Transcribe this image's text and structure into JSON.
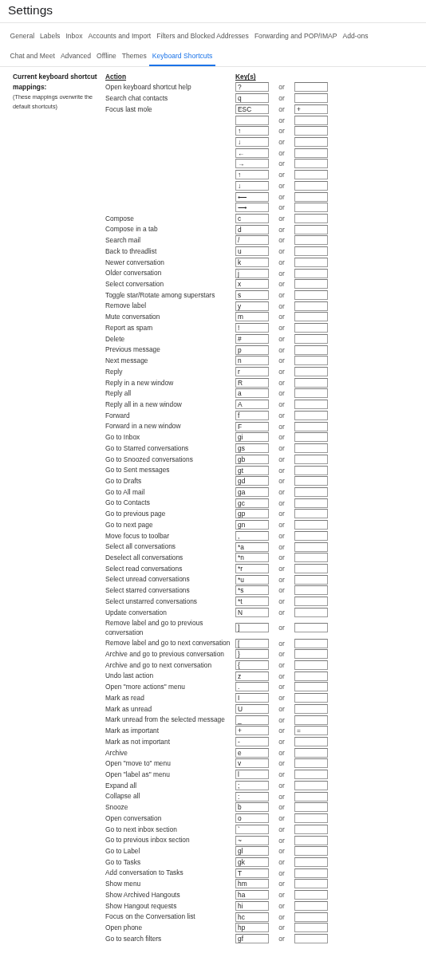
{
  "header": {
    "title": "Settings"
  },
  "tabs": [
    {
      "label": "General",
      "selected": false
    },
    {
      "label": "Labels",
      "selected": false
    },
    {
      "label": "Inbox",
      "selected": false
    },
    {
      "label": "Accounts and Import",
      "selected": false
    },
    {
      "label": "Filters and Blocked Addresses",
      "selected": false
    },
    {
      "label": "Forwarding and POP/IMAP",
      "selected": false
    },
    {
      "label": "Add-ons",
      "selected": false
    },
    {
      "label": "Chat and Meet",
      "selected": false
    },
    {
      "label": "Advanced",
      "selected": false
    },
    {
      "label": "Offline",
      "selected": false
    },
    {
      "label": "Themes",
      "selected": false
    },
    {
      "label": "Keyboard Shortcuts",
      "selected": true
    }
  ],
  "section": {
    "title": "Current keyboard shortcut mappings:",
    "note": "(These mappings overwrite the default shortcuts)"
  },
  "columns": {
    "action": "Action",
    "keys": "Key(s)"
  },
  "shortcuts": [
    {
      "action": "Open keyboard shortcut help",
      "key": "?",
      "separator": "or"
    },
    {
      "action": "Search chat contacts",
      "key": "q",
      "separator": "or"
    },
    {
      "action": "Focus last mole",
      "key": "ESC",
      "separator": "or",
      "alt_key": "+"
    },
    {
      "separator": "or"
    },
    {
      "key": "↑",
      "separator": "or"
    },
    {
      "key": "↓",
      "separator": "or"
    },
    {
      "key": "←",
      "separator": "or"
    },
    {
      "key": "→",
      "separator": "or"
    },
    {
      "key": "↑",
      "separator": "or"
    },
    {
      "key": "↓",
      "separator": "or"
    },
    {
      "key": "⟵",
      "separator": "or"
    },
    {
      "key": "⟶",
      "separator": "or"
    },
    {
      "action": "Compose",
      "key": "c",
      "separator": "or"
    },
    {
      "action": "Compose in a tab",
      "key": "d",
      "separator": "or"
    },
    {
      "action": "Search mail",
      "key": "/",
      "separator": "or"
    },
    {
      "action": "Back to threadlist",
      "key": "u",
      "separator": "or"
    },
    {
      "action": "Newer conversation",
      "key": "k",
      "separator": "or"
    },
    {
      "action": "Older conversation",
      "key": "j",
      "separator": "or"
    },
    {
      "action": "Select conversation",
      "key": "x",
      "separator": "or"
    },
    {
      "action": "Toggle star/Rotate among superstars",
      "key": "s",
      "separator": "or"
    },
    {
      "action": "Remove label",
      "key": "y",
      "separator": "or"
    },
    {
      "action": "Mute conversation",
      "key": "m",
      "separator": "or"
    },
    {
      "action": "Report as spam",
      "key": "!",
      "separator": "or"
    },
    {
      "action": "Delete",
      "key": "#",
      "separator": "or"
    },
    {
      "action": "Previous message",
      "key": "p",
      "separator": "or"
    },
    {
      "action": "Next message",
      "key": "n",
      "separator": "or"
    },
    {
      "action": "Reply",
      "key": "r",
      "separator": "or"
    },
    {
      "action": "Reply in a new window",
      "key": "R",
      "separator": "or"
    },
    {
      "action": "Reply all",
      "key": "a",
      "separator": "or"
    },
    {
      "action": "Reply all in a new window",
      "key": "A",
      "separator": "or"
    },
    {
      "action": "Forward",
      "key": "f",
      "separator": "or"
    },
    {
      "action": "Forward in a new window",
      "key": "F",
      "separator": "or"
    },
    {
      "action": "Go to Inbox",
      "key": "gi",
      "separator": "or"
    },
    {
      "action": "Go to Starred conversations",
      "key": "gs",
      "separator": "or"
    },
    {
      "action": "Go to Snoozed conversations",
      "key": "gb",
      "separator": "or"
    },
    {
      "action": "Go to Sent messages",
      "key": "gt",
      "separator": "or"
    },
    {
      "action": "Go to Drafts",
      "key": "gd",
      "separator": "or"
    },
    {
      "action": "Go to All mail",
      "key": "ga",
      "separator": "or"
    },
    {
      "action": "Go to Contacts",
      "key": "gc",
      "separator": "or"
    },
    {
      "action": "Go to previous page",
      "key": "gp",
      "separator": "or"
    },
    {
      "action": "Go to next page",
      "key": "gn",
      "separator": "or"
    },
    {
      "action": "Move focus to toolbar",
      "key": ",",
      "separator": "or"
    },
    {
      "action": "Select all conversations",
      "key": "*a",
      "separator": "or"
    },
    {
      "action": "Deselect all conversations",
      "key": "*n",
      "separator": "or"
    },
    {
      "action": "Select read conversations",
      "key": "*r",
      "separator": "or"
    },
    {
      "action": "Select unread conversations",
      "key": "*u",
      "separator": "or"
    },
    {
      "action": "Select starred conversations",
      "key": "*s",
      "separator": "or"
    },
    {
      "action": "Select unstarred conversations",
      "key": "*t",
      "separator": "or"
    },
    {
      "action": "Update conversation",
      "key": "N",
      "separator": "or"
    },
    {
      "action": "Remove label and go to previous conversation",
      "key": "]",
      "separator": "or"
    },
    {
      "action": "Remove label and go to next conversation",
      "key": "[",
      "separator": "or"
    },
    {
      "action": "Archive and go to previous conversation",
      "key": "}",
      "separator": "or"
    },
    {
      "action": "Archive and go to next conversation",
      "key": "{",
      "separator": "or"
    },
    {
      "action": "Undo last action",
      "key": "z",
      "separator": "or"
    },
    {
      "action": "Open \"more actions\" menu",
      "key": ".",
      "separator": "or"
    },
    {
      "action": "Mark as read",
      "key": "I",
      "separator": "or"
    },
    {
      "action": "Mark as unread",
      "key": "U",
      "separator": "or"
    },
    {
      "action": "Mark unread from the selected message",
      "key": "_",
      "separator": "or"
    },
    {
      "action": "Mark as important",
      "key": "+",
      "separator": "or",
      "alt_key": "="
    },
    {
      "action": "Mark as not important",
      "key": "-",
      "separator": "or"
    },
    {
      "action": "Archive",
      "key": "e",
      "separator": "or"
    },
    {
      "action": "Open \"move to\" menu",
      "key": "v",
      "separator": "or"
    },
    {
      "action": "Open \"label as\" menu",
      "key": "l",
      "separator": "or"
    },
    {
      "action": "Expand all",
      "key": ";",
      "separator": "or"
    },
    {
      "action": "Collapse all",
      "key": ":",
      "separator": "or"
    },
    {
      "action": "Snooze",
      "key": "b",
      "separator": "or"
    },
    {
      "action": "Open conversation",
      "key": "o",
      "separator": "or"
    },
    {
      "action": "Go to next inbox section",
      "key": "`",
      "separator": "or"
    },
    {
      "action": "Go to previous inbox section",
      "key": "~",
      "separator": "or"
    },
    {
      "action": "Go to Label",
      "key": "gl",
      "separator": "or"
    },
    {
      "action": "Go to Tasks",
      "key": "gk",
      "separator": "or"
    },
    {
      "action": "Add conversation to Tasks",
      "key": "T",
      "separator": "or"
    },
    {
      "action": "Show menu",
      "key": "hm",
      "separator": "or"
    },
    {
      "action": "Show Archived Hangouts",
      "key": "ha",
      "separator": "or"
    },
    {
      "action": "Show Hangout requests",
      "key": "hi",
      "separator": "or"
    },
    {
      "action": "Focus on the Conversation list",
      "key": "hc",
      "separator": "or"
    },
    {
      "action": "Open phone",
      "key": "hp",
      "separator": "or"
    },
    {
      "action": "Go to search filters",
      "key": "gf",
      "separator": "or"
    }
  ]
}
